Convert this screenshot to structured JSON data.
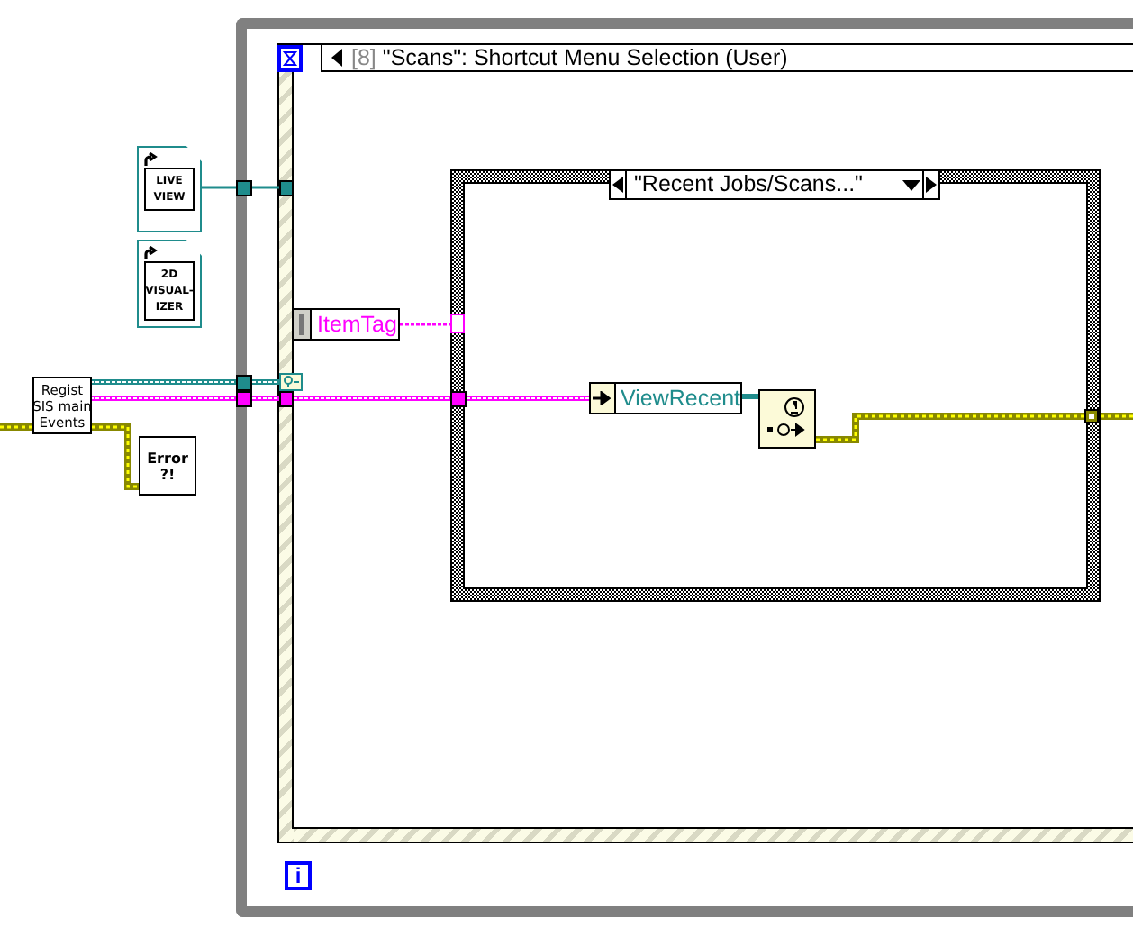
{
  "event_structure": {
    "case_index": "[8]",
    "case_name": "\"Scans\": Shortcut Menu Selection (User)"
  },
  "case_structure": {
    "selector": "\"Recent Jobs/Scans...\""
  },
  "subvi_icons": [
    {
      "lines": [
        "LIVE",
        "VIEW"
      ]
    },
    {
      "lines": [
        "2D",
        "VISUAL-",
        "IZER"
      ]
    }
  ],
  "register_node": {
    "lines": [
      "Regist",
      "SIS main",
      "Events"
    ]
  },
  "error_node": {
    "lines": [
      "Error",
      "?!"
    ]
  },
  "unbundle_item": "ItemTag",
  "enum_constant": "ViewRecent",
  "loop_iteration": "i"
}
